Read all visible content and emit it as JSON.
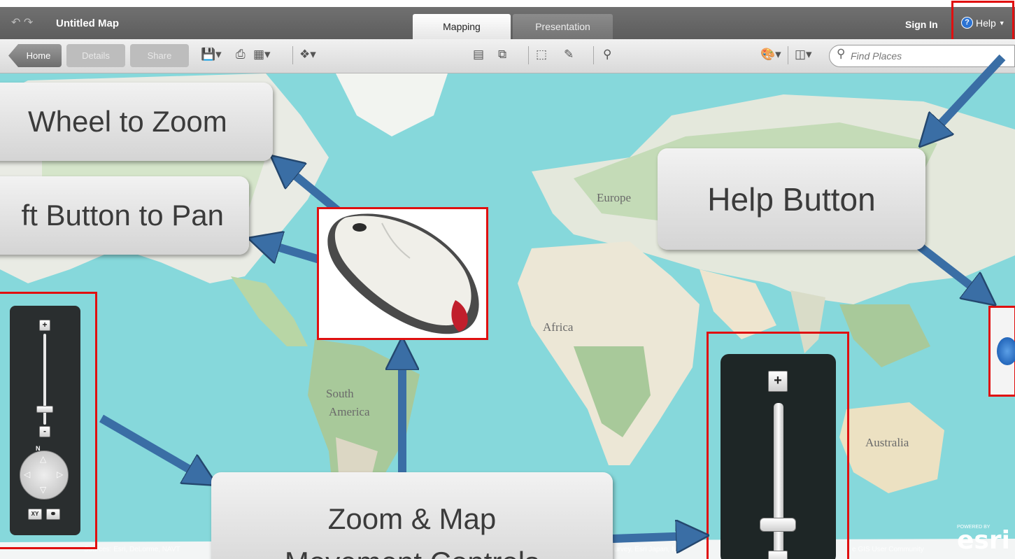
{
  "titlebar": {
    "map_title": "Untitled Map",
    "tabs": [
      {
        "label": "Mapping",
        "active": true
      },
      {
        "label": "Presentation",
        "active": false
      }
    ],
    "sign_in": "Sign In",
    "help": "Help",
    "help_icon": "?"
  },
  "toolbar": {
    "home": "Home",
    "details": "Details",
    "share": "Share",
    "search_placeholder": "Find Places"
  },
  "map": {
    "labels": {
      "europe": "Europe",
      "africa": "Africa",
      "south": "South",
      "america": "America",
      "australia": "Australia"
    },
    "attribution_left": "Sources: Esri, DeLorme, NAVT",
    "attribution_mid": "urvey, Esri Japan, ME",
    "attribution_right": "e GIS User Community",
    "esri_powered": "POWERED BY",
    "esri_word": "esri"
  },
  "callouts": {
    "wheel": "Wheel to Zoom",
    "left_button": "ft Button to Pan",
    "help_button": "Help Button",
    "zoom_line1": "Zoom & Map",
    "zoom_line2": "Movement Controls"
  },
  "zoom_controls": {
    "plus": "+",
    "minus": "-",
    "north": "N",
    "xy": "XY"
  },
  "colors": {
    "highlight": "#e01010",
    "arrow": "#3a6ea5",
    "ocean": "#86d8db",
    "land": "#eae9e2",
    "vegetation": "#a8c99a"
  }
}
